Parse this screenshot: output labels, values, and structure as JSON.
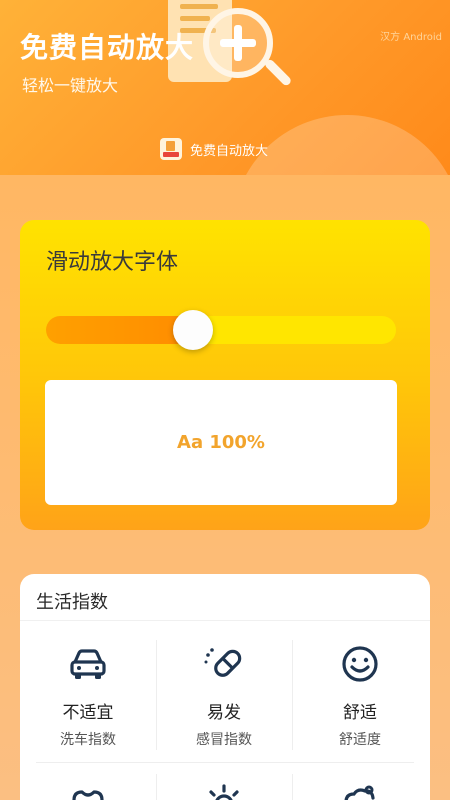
{
  "header": {
    "title": "免费自动放大",
    "subtitle": "轻松一键放大",
    "corner_text": "汉方 Android",
    "badge_text": "免费自动放大"
  },
  "slider_card": {
    "title": "滑动放大字体",
    "preview_text": "Aa 100%",
    "value_fraction": 0.42
  },
  "life_index": {
    "title": "生活指数",
    "items": [
      {
        "value": "不适宜",
        "label": "洗车指数",
        "icon": "car-icon"
      },
      {
        "value": "易发",
        "label": "感冒指数",
        "icon": "pill-icon"
      },
      {
        "value": "舒适",
        "label": "舒适度",
        "icon": "smiley-icon"
      },
      {
        "value": "",
        "label": "",
        "icon": "shirt-icon"
      },
      {
        "value": "",
        "label": "",
        "icon": "sun-icon"
      },
      {
        "value": "",
        "label": "",
        "icon": "cloud-icon"
      }
    ]
  },
  "colors": {
    "accent": "#ff9a2a",
    "slider_fill": "#ff8c00",
    "preview_text": "#f2a42c",
    "icon": "#1f3550"
  }
}
